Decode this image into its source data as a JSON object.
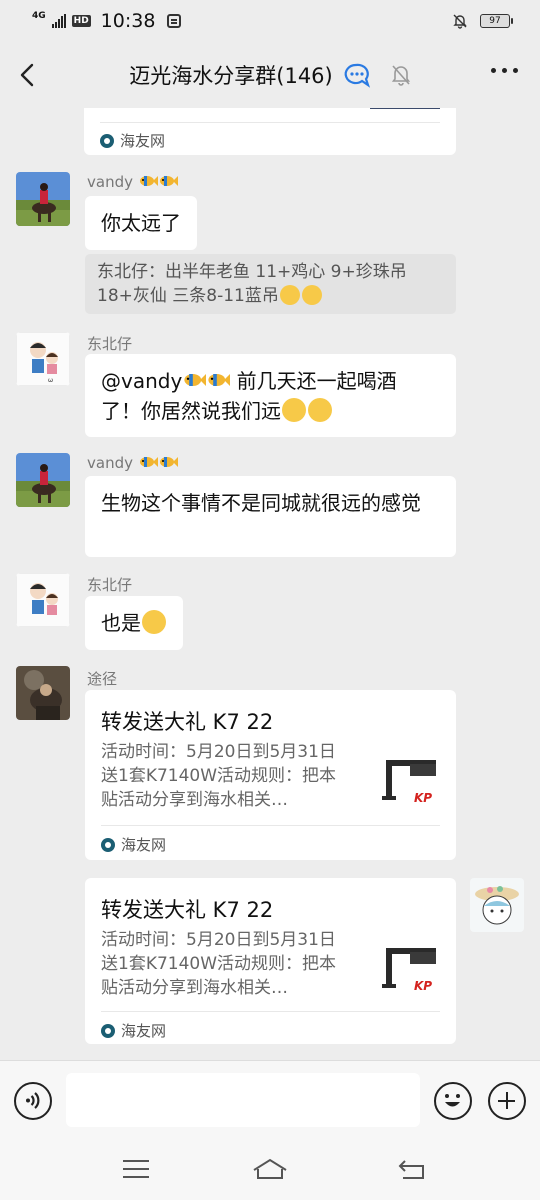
{
  "status": {
    "network": "4G",
    "hd": "HD",
    "time": "10:38",
    "battery": "97"
  },
  "header": {
    "title": "迈光海水分享群(146)"
  },
  "messages": {
    "top_card_source": "海友网",
    "m1_sender": "vandy",
    "m1_text": "你太远了",
    "m1_quote_line1": "东北仔：出半年老鱼 11+鸡心 9+珍珠吊",
    "m1_quote_line2": "18+灰仙 三条8-11蓝吊",
    "m2_sender": "东北仔",
    "m2_line1": "@vandy",
    "m2_line1b": " 前几天还一起喝酒",
    "m2_line2": "了！你居然说我们远",
    "m3_sender": "vandy",
    "m3_text": "生物这个事情不是同城就很远的感觉",
    "m4_sender": "东北仔",
    "m4_text": "也是",
    "m5_sender": "途径",
    "card1_title": "转发送大礼 K7 22",
    "card1_desc": "活动时间：5月20日到5月31日送1套K7140W活动规则：把本贴活动分享到海水相关…",
    "card1_source": "海友网",
    "card2_title": "转发送大礼 K7 22",
    "card2_desc": "活动时间：5月20日到5月31日送1套K7140W活动规则：把本贴活动分享到海水相关…",
    "card2_source": "海友网"
  },
  "icons": {
    "back": "chevron-left-icon",
    "group_chat": "group-chat-icon",
    "mute": "bell-off-icon",
    "more": "more-dots-icon",
    "voice": "voice-icon",
    "emoji": "emoji-icon",
    "plus": "plus-icon"
  },
  "colors": {
    "background": "#ededed",
    "bubble": "#ffffff",
    "quote_bg": "#e3e3e3",
    "source_icon": "#1b5e73",
    "kp_red": "#d4231f"
  }
}
